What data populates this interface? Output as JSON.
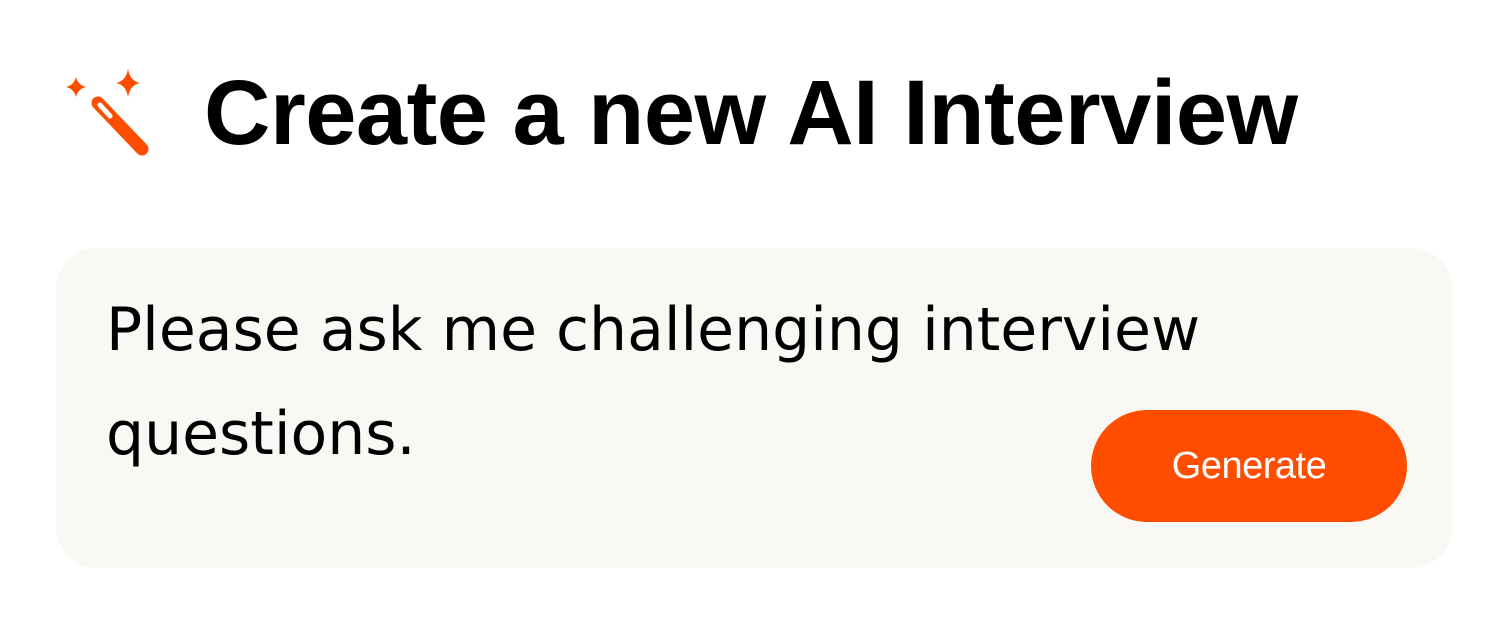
{
  "header": {
    "icon": "magic-wand-sparkles-icon",
    "title": "Create a new AI Interview"
  },
  "prompt": {
    "text": "Please ask me challenging interview questions."
  },
  "actions": {
    "generate_label": "Generate"
  },
  "colors": {
    "accent": "#ff4d00",
    "card_background": "#f9f8f5",
    "text": "#000000"
  }
}
